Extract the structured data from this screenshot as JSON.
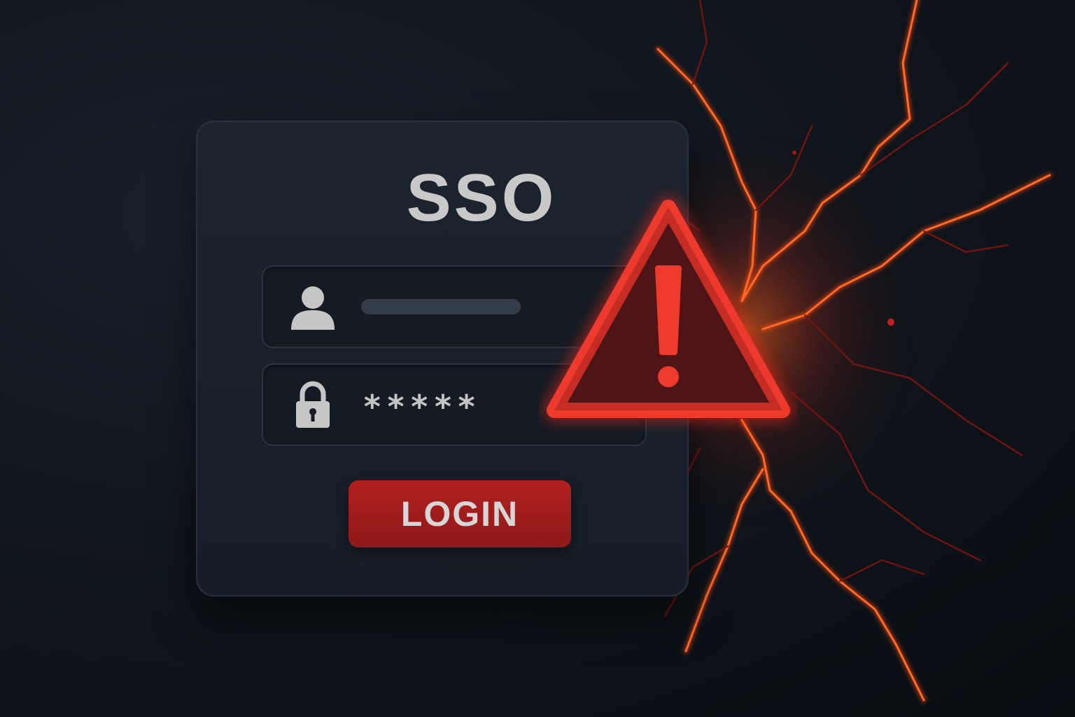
{
  "login_form": {
    "title": "SSO",
    "password_mask": "*****",
    "login_label": "LOGIN"
  },
  "icons": {
    "username": "user-icon",
    "password": "lock-icon",
    "alert": "warning-icon"
  },
  "colors": {
    "background": "#0d1218",
    "card": "#1a222c",
    "text": "#c9c9c9",
    "button": "#a81e1e",
    "warning": "#e8302a",
    "crack_glow": "#ff5a1f"
  }
}
